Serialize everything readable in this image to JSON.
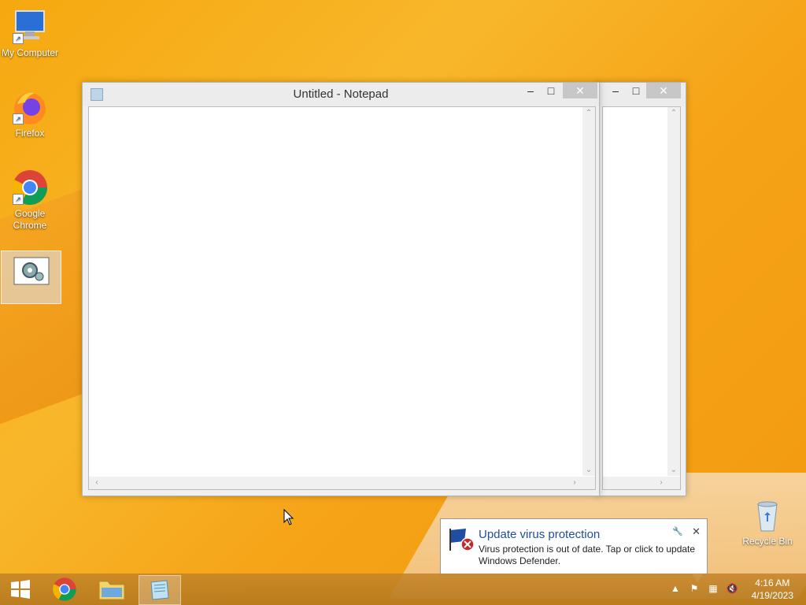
{
  "desktop": {
    "icons": [
      {
        "name": "My Computer"
      },
      {
        "name": "Firefox"
      },
      {
        "name": "Google Chrome"
      },
      {
        "name": "Recycle Bin"
      }
    ]
  },
  "notepad": {
    "title": "Untitled - Notepad",
    "minimize": "–",
    "maximize": "□",
    "close": "✕"
  },
  "second_window": {
    "minimize": "–",
    "maximize": "□",
    "close": "✕"
  },
  "notification": {
    "title": "Update virus protection",
    "body": "Virus protection is out of date. Tap or click to update Windows Defender."
  },
  "taskbar": {
    "time": "4:16 AM",
    "date": "4/19/2023"
  }
}
